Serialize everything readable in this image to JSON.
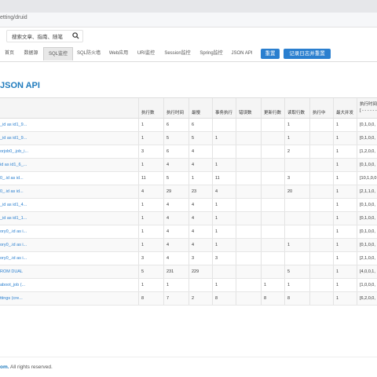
{
  "browser": {
    "url": "etting/druid"
  },
  "search": {
    "placeholder": "搜索文章、指南、随笔"
  },
  "nav": {
    "tabs": [
      "首页",
      "数据源",
      "SQL监控",
      "SQL防火墙",
      "Web应用",
      "URI监控",
      "Session监控",
      "Spring监控",
      "JSON API"
    ],
    "active": "SQL监控",
    "reset_label": "重置",
    "log_reset_label": "记录日志并重置"
  },
  "page": {
    "title": "JSON API"
  },
  "table": {
    "headers": [
      "执行数",
      "执行时间",
      "最慢",
      "事务执行",
      "错误数",
      "更新行数",
      "读取行数",
      "执行中",
      "最大并发"
    ],
    "last_header": [
      "执行时间分",
      "[ - - - - - -"
    ],
    "rows": [
      {
        "sql": "_id as id1_9...",
        "c": [
          "1",
          "6",
          "6",
          "",
          "",
          "",
          "1",
          "",
          "1"
        ],
        "dist": "[0,1,0,0,"
      },
      {
        "sql": "_id as id1_9...",
        "c": [
          "1",
          "5",
          "5",
          "1",
          "",
          "",
          "1",
          "",
          "1"
        ],
        "dist": "[0,1,0,0,"
      },
      {
        "sql": "orjob0_.job_i...",
        "c": [
          "3",
          "6",
          "4",
          "",
          "",
          "",
          "2",
          "",
          "1"
        ],
        "dist": "[1,2,0,0,"
      },
      {
        "sql": "id as id1_6_...",
        "c": [
          "1",
          "4",
          "4",
          "1",
          "",
          "",
          "",
          "",
          "1"
        ],
        "dist": "[0,1,0,0,"
      },
      {
        "sql": "0_.id as id...",
        "c": [
          "11",
          "5",
          "1",
          "11",
          "",
          "",
          "3",
          "",
          "1"
        ],
        "dist": "[10,1,0,0"
      },
      {
        "sql": "0_.id as id...",
        "c": [
          "4",
          "29",
          "23",
          "4",
          "",
          "",
          "20",
          "",
          "1"
        ],
        "dist": "[2,1,1,0,"
      },
      {
        "sql": "_id as id1_4...",
        "c": [
          "1",
          "4",
          "4",
          "1",
          "",
          "",
          "",
          "",
          "1"
        ],
        "dist": "[0,1,0,0,"
      },
      {
        "sql": "_id as id1_1...",
        "c": [
          "1",
          "4",
          "4",
          "1",
          "",
          "",
          "",
          "",
          "1"
        ],
        "dist": "[0,1,0,0,"
      },
      {
        "sql": "ory0_.id as i...",
        "c": [
          "1",
          "4",
          "4",
          "1",
          "",
          "",
          "",
          "",
          "1"
        ],
        "dist": "[0,1,0,0,"
      },
      {
        "sql": "ory0_.id as i...",
        "c": [
          "1",
          "4",
          "4",
          "1",
          "",
          "",
          "1",
          "",
          "1"
        ],
        "dist": "[0,1,0,0,"
      },
      {
        "sql": "ory0_.id as i...",
        "c": [
          "3",
          "4",
          "3",
          "3",
          "",
          "",
          "",
          "",
          "1"
        ],
        "dist": "[2,1,0,0,"
      },
      {
        "sql": "ROM DUAL",
        "c": [
          "5",
          "231",
          "229",
          "",
          "",
          "",
          "5",
          "",
          "1"
        ],
        "dist": "[4,0,0,1,"
      },
      {
        "sql": "aboot_job (...",
        "c": [
          "1",
          "1",
          "",
          "1",
          "",
          "1",
          "1",
          "",
          "1"
        ],
        "dist": "[1,0,0,0,"
      },
      {
        "sql": "ttings (cre...",
        "c": [
          "8",
          "7",
          "2",
          "8",
          "",
          "8",
          "8",
          "",
          "1"
        ],
        "dist": "[6,2,0,0,"
      }
    ]
  },
  "footer": {
    "brand": "om.",
    "rights": " All rights reserved."
  }
}
